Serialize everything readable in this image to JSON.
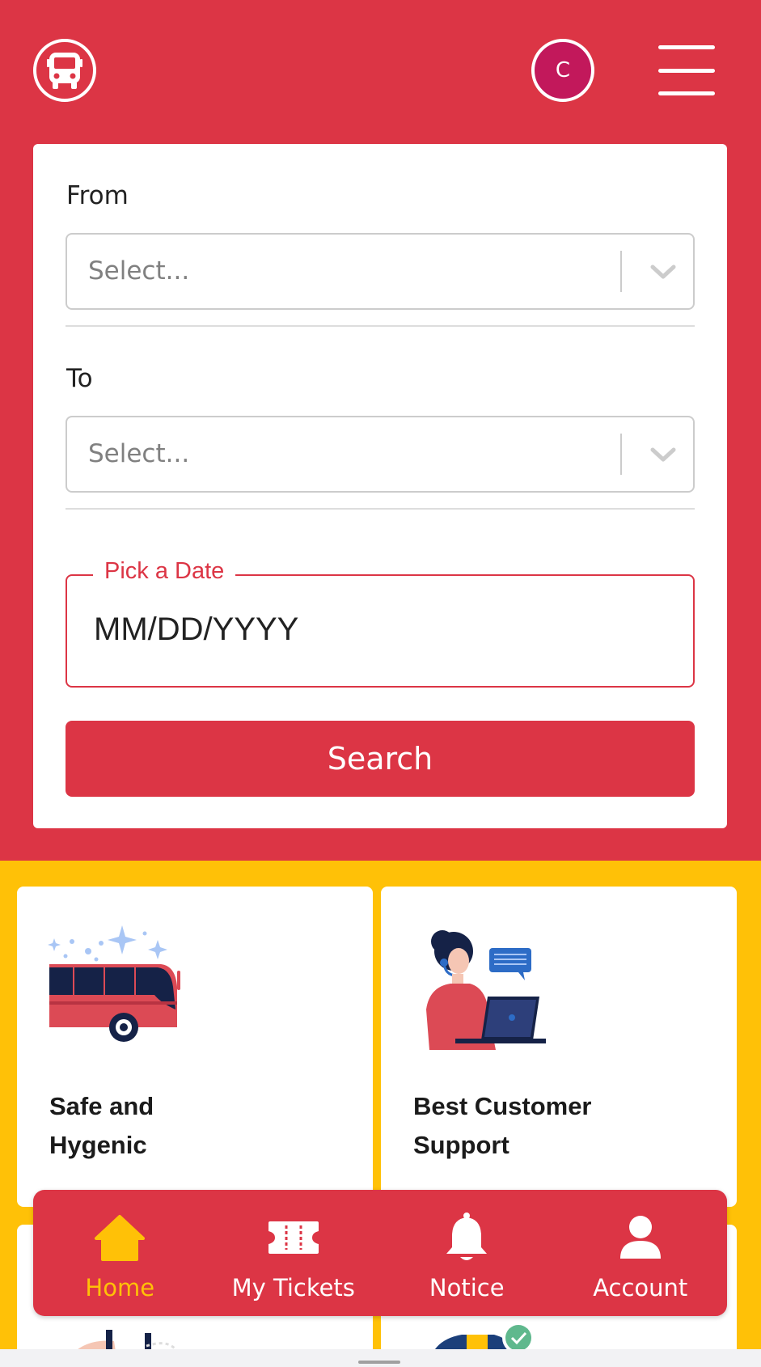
{
  "header": {
    "logo_icon": "bus-icon",
    "avatar_initial": "C",
    "menu_icon": "hamburger-menu-icon"
  },
  "search_form": {
    "from": {
      "label": "From",
      "placeholder": "Select..."
    },
    "to": {
      "label": "To",
      "placeholder": "Select..."
    },
    "date": {
      "label": "Pick a Date",
      "placeholder": "MM/DD/YYYY"
    },
    "search_label": "Search"
  },
  "features": [
    {
      "title_line1": "Safe and",
      "title_line2": "Hygenic",
      "icon": "clean-bus-illustration"
    },
    {
      "title_line1": "Best Customer",
      "title_line2": "Support",
      "icon": "customer-support-illustration"
    }
  ],
  "bottom_nav": {
    "items": [
      {
        "label": "Home",
        "icon": "home-icon",
        "active": true
      },
      {
        "label": "My Tickets",
        "icon": "ticket-icon",
        "active": false
      },
      {
        "label": "Notice",
        "icon": "bell-icon",
        "active": false
      },
      {
        "label": "Account",
        "icon": "user-icon",
        "active": false
      }
    ]
  },
  "colors": {
    "primary": "#dc3545",
    "accent": "#ffc107",
    "avatar": "#c2185b"
  }
}
